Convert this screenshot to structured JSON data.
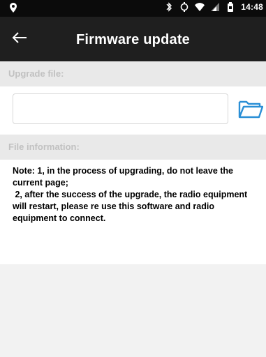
{
  "status_bar": {
    "time": "14:48",
    "icons": [
      "location-pin-icon",
      "bluetooth-icon",
      "sync-icon",
      "wifi-icon",
      "signal-icon",
      "battery-icon"
    ]
  },
  "app_bar": {
    "title": "Firmware update",
    "back_icon": "arrow-left-icon"
  },
  "upgrade_section": {
    "label": "Upgrade file:",
    "file_input_value": "",
    "folder_icon": "folder-open-icon",
    "accent_color": "#2a8fd6"
  },
  "info_section": {
    "label": "File information:"
  },
  "note": {
    "text": "Note: 1, in the process of upgrading, do not leave the current page;\n 2, after the success of the upgrade, the radio equipment will restart, please re use this software and radio equipment to connect."
  }
}
